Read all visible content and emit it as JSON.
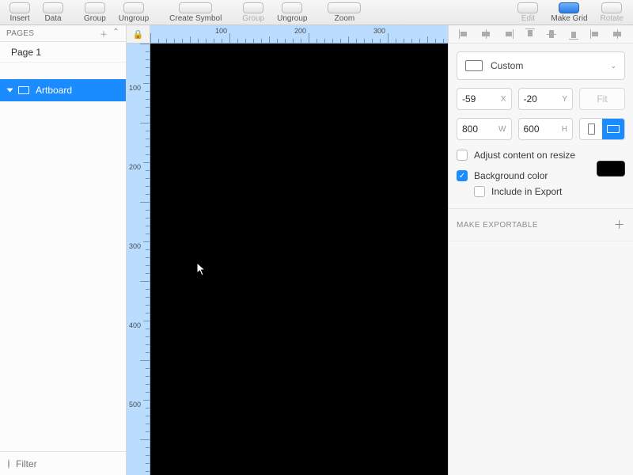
{
  "toolbar": {
    "insert": "Insert",
    "data": "Data",
    "group": "Group",
    "ungroup": "Ungroup",
    "create_symbol": "Create Symbol",
    "group2": "Group",
    "ungroup2": "Ungroup",
    "zoom": "Zoom",
    "edit": "Edit",
    "make_grid": "Make Grid",
    "rotate": "Rotate"
  },
  "pages": {
    "title": "PAGES",
    "page1": "Page 1"
  },
  "layers": {
    "artboard": "Artboard"
  },
  "filter": {
    "placeholder": "Filter"
  },
  "ruler": {
    "top_labels": [
      "100",
      "200",
      "300"
    ],
    "left_labels": [
      "100",
      "200",
      "300",
      "400",
      "500"
    ]
  },
  "inspector": {
    "size_preset": "Custom",
    "x": "-59",
    "y": "-20",
    "fit": "Fit",
    "w": "800",
    "h": "600",
    "x_u": "X",
    "y_u": "Y",
    "w_u": "W",
    "h_u": "H",
    "adjust": "Adjust content on resize",
    "bg": "Background color",
    "include": "Include in Export",
    "export": "MAKE EXPORTABLE",
    "bg_color": "#000000"
  }
}
